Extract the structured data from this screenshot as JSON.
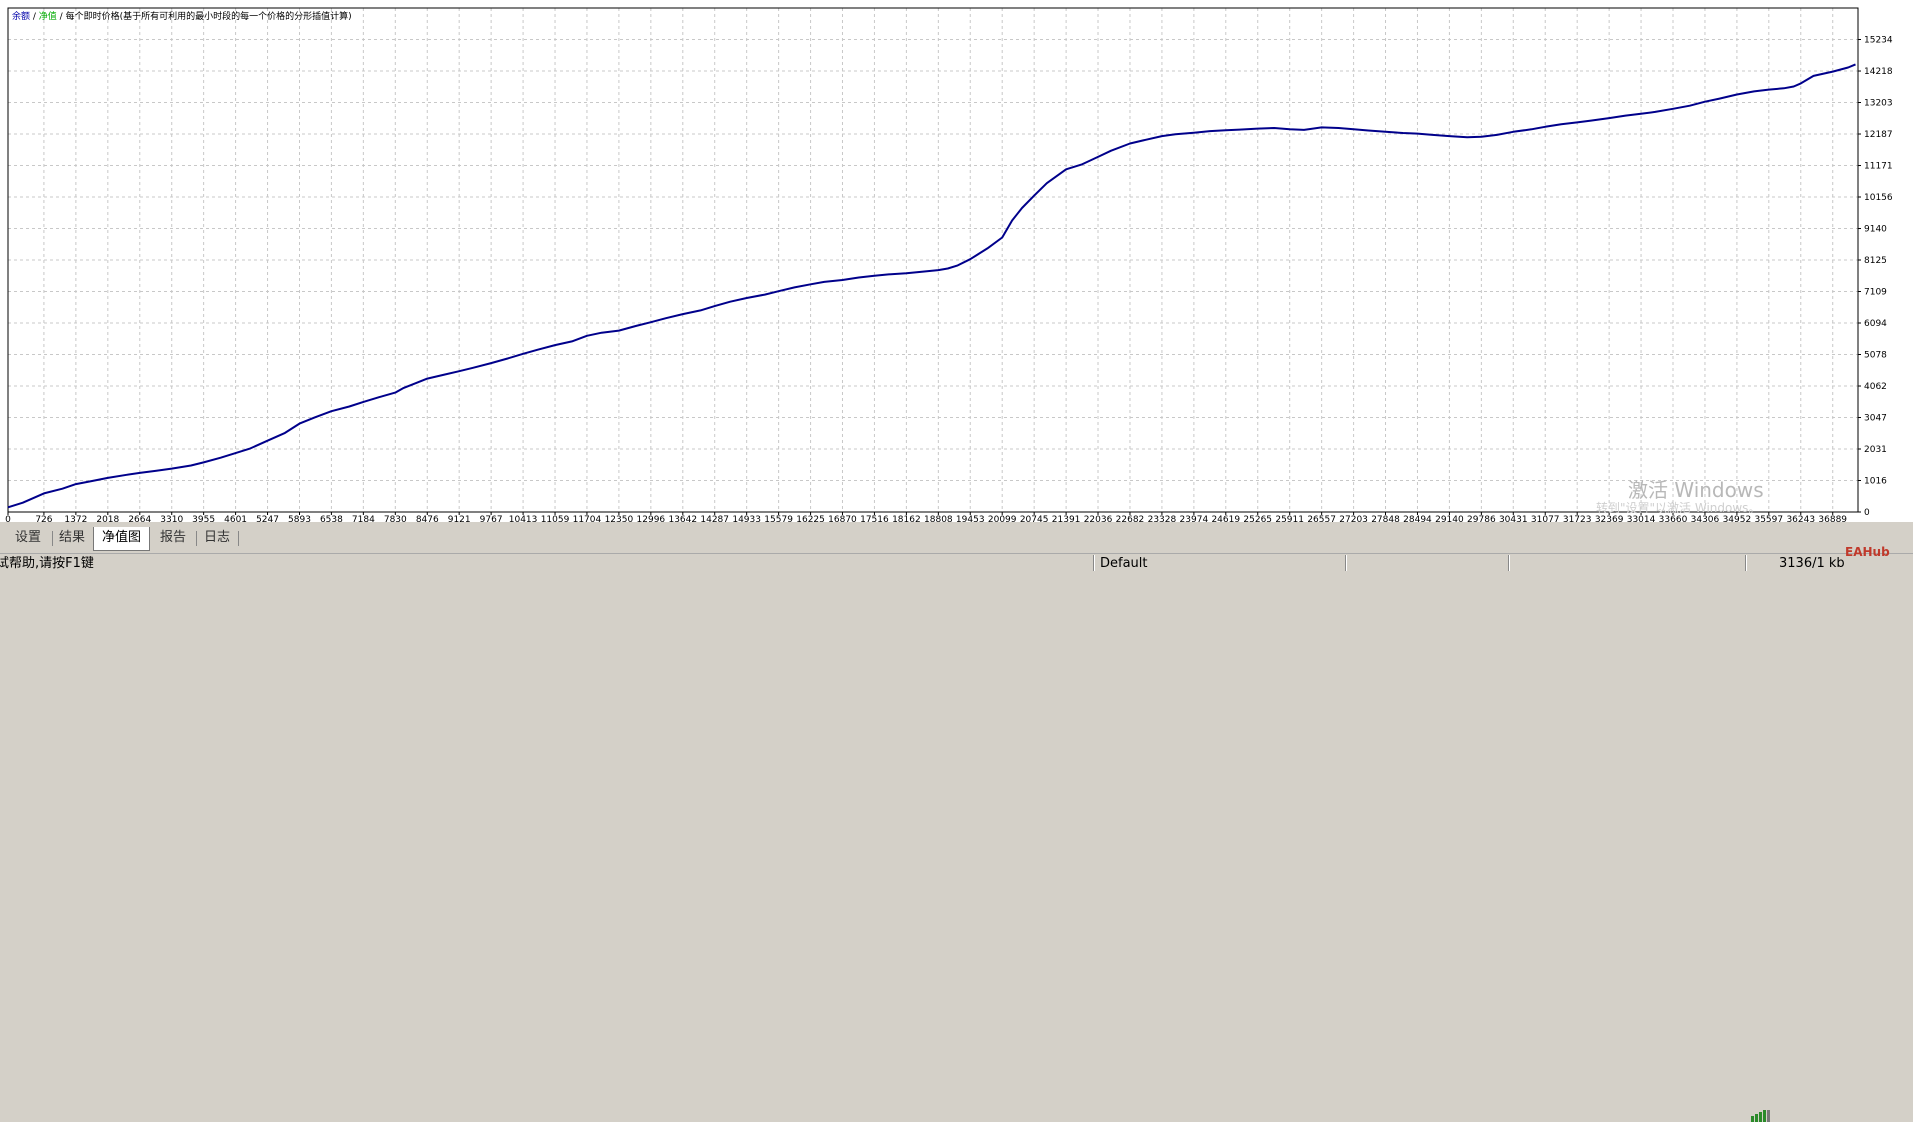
{
  "legend": {
    "balance": "余额",
    "sep1": " / ",
    "equity": "净值",
    "sep2": " / ",
    "desc": "每个即时价格(基于所有可利用的最小时段的每一个价格的分形插值计算)"
  },
  "chart_data": {
    "type": "line",
    "title": "",
    "xlabel": "",
    "ylabel": "",
    "xlim": [
      0,
      37400
    ],
    "ylim": [
      0,
      16250
    ],
    "x_ticks": [
      0,
      726,
      1372,
      2018,
      2664,
      3310,
      3955,
      4601,
      5247,
      5893,
      6538,
      7184,
      7830,
      8476,
      9121,
      9767,
      10413,
      11059,
      11704,
      12350,
      12996,
      13642,
      14287,
      14933,
      15579,
      16225,
      16870,
      17516,
      18162,
      18808,
      19453,
      20099,
      20745,
      21391,
      22036,
      22682,
      23328,
      23974,
      24619,
      25265,
      25911,
      26557,
      27203,
      27848,
      28494,
      29140,
      29786,
      30431,
      31077,
      31723,
      32369,
      33014,
      33660,
      34306,
      34952,
      35597,
      36243,
      36889
    ],
    "y_ticks": [
      0,
      1016,
      2031,
      3047,
      4062,
      5078,
      6094,
      7109,
      8125,
      9140,
      10156,
      11171,
      12187,
      13203,
      14218,
      15234
    ],
    "series": [
      {
        "color": "#00008b",
        "x": [
          0,
          300,
          726,
          1100,
          1372,
          1700,
          2018,
          2400,
          2664,
          3000,
          3310,
          3700,
          3955,
          4300,
          4601,
          4900,
          5247,
          5600,
          5893,
          6200,
          6538,
          6900,
          7184,
          7500,
          7830,
          8000,
          8476,
          8800,
          9121,
          9400,
          9767,
          10100,
          10413,
          10700,
          11059,
          11400,
          11704,
          12000,
          12350,
          12700,
          12996,
          13300,
          13642,
          14000,
          14287,
          14600,
          14933,
          15300,
          15579,
          15900,
          16225,
          16500,
          16870,
          17200,
          17516,
          17800,
          18162,
          18500,
          18808,
          19000,
          19200,
          19453,
          19600,
          19800,
          20099,
          20300,
          20500,
          20745,
          21000,
          21391,
          21700,
          22036,
          22300,
          22682,
          23000,
          23328,
          23600,
          23974,
          24300,
          24619,
          24900,
          25265,
          25600,
          25911,
          26200,
          26557,
          26900,
          27203,
          27500,
          27848,
          28200,
          28494,
          28800,
          29140,
          29500,
          29786,
          30100,
          30431,
          30800,
          31077,
          31400,
          31723,
          32000,
          32369,
          32700,
          33014,
          33300,
          33660,
          34000,
          34306,
          34600,
          34952,
          35300,
          35597,
          35900,
          36100,
          36243,
          36500,
          36889,
          37200,
          37350
        ],
        "y": [
          150,
          300,
          600,
          750,
          900,
          1000,
          1100,
          1200,
          1260,
          1330,
          1400,
          1500,
          1600,
          1750,
          1900,
          2050,
          2300,
          2550,
          2850,
          3050,
          3250,
          3400,
          3550,
          3700,
          3850,
          4000,
          4300,
          4420,
          4540,
          4650,
          4800,
          4950,
          5100,
          5230,
          5380,
          5500,
          5680,
          5780,
          5850,
          6000,
          6120,
          6250,
          6380,
          6500,
          6640,
          6780,
          6900,
          7010,
          7120,
          7240,
          7340,
          7420,
          7480,
          7560,
          7620,
          7660,
          7700,
          7750,
          7800,
          7850,
          7950,
          8150,
          8300,
          8500,
          8850,
          9400,
          9800,
          10200,
          10600,
          11050,
          11200,
          11450,
          11650,
          11880,
          12000,
          12120,
          12180,
          12230,
          12280,
          12310,
          12330,
          12360,
          12380,
          12340,
          12320,
          12400,
          12380,
          12340,
          12300,
          12260,
          12220,
          12200,
          12160,
          12120,
          12080,
          12100,
          12160,
          12260,
          12340,
          12420,
          12500,
          12560,
          12620,
          12700,
          12780,
          12840,
          12900,
          13000,
          13100,
          13230,
          13330,
          13460,
          13560,
          13620,
          13660,
          13720,
          13820,
          14060,
          14200,
          14330,
          14430
        ]
      }
    ]
  },
  "tabs": [
    {
      "label": "设置"
    },
    {
      "label": "结果"
    },
    {
      "label": "净值图"
    },
    {
      "label": "报告"
    },
    {
      "label": "日志"
    }
  ],
  "status": {
    "help": "试帮助,请按F1键",
    "profile": "Default",
    "traffic": "3136/1 kb"
  },
  "watermark": {
    "line1": "激活 Windows",
    "line2": "转到\"设置\"以激活 Windows。"
  },
  "brand": "EAHub"
}
